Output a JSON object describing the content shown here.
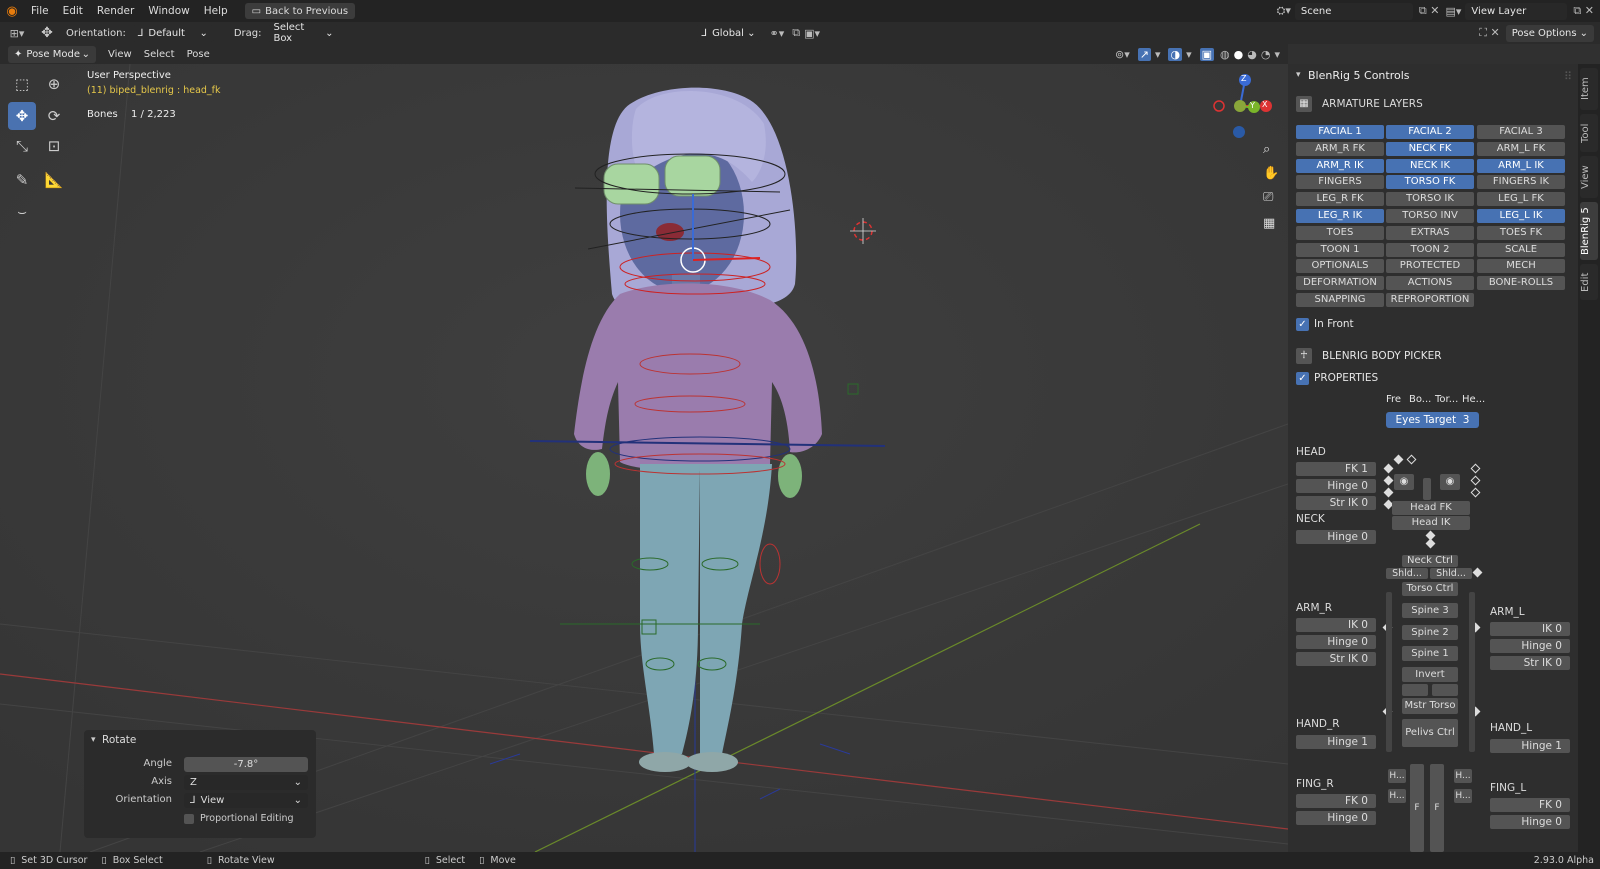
{
  "menu": {
    "logo": "blender-logo",
    "items": [
      "File",
      "Edit",
      "Render",
      "Window",
      "Help"
    ],
    "back_label": "Back to Previous"
  },
  "topright": {
    "scene_label": "Scene",
    "viewlayer_label": "View Layer"
  },
  "header": {
    "orientation_label": "Orientation:",
    "orientation_value": "Default",
    "drag_label": "Drag:",
    "drag_value": "Select Box",
    "transform_orientation": "Global",
    "pose_options": "Pose Options"
  },
  "header3": {
    "mode": "Pose Mode",
    "items": [
      "View",
      "Select",
      "Pose"
    ]
  },
  "viewport": {
    "perspective": "User Perspective",
    "object_info": "(11) biped_blenrig : head_fk",
    "bones_label": "Bones",
    "bones_value": "1 / 2,223"
  },
  "gizmo": {
    "z": "Z",
    "y": "Y",
    "x": "X"
  },
  "rotate": {
    "title": "Rotate",
    "angle_label": "Angle",
    "angle_value": "-7.8°",
    "axis_label": "Axis",
    "axis_value": "Z",
    "orient_label": "Orientation",
    "orient_value": "View",
    "proportional_label": "Proportional Editing"
  },
  "panel": {
    "title": "BlenRig 5 Controls",
    "armature_layers_title": "ARMATURE LAYERS",
    "layers": [
      {
        "label": "FACIAL 1",
        "on": true
      },
      {
        "label": "FACIAL 2",
        "on": true
      },
      {
        "label": "FACIAL 3",
        "on": false
      },
      {
        "label": "ARM_R FK",
        "on": false
      },
      {
        "label": "NECK FK",
        "on": true
      },
      {
        "label": "ARM_L FK",
        "on": false
      },
      {
        "label": "ARM_R IK",
        "on": true
      },
      {
        "label": "NECK IK",
        "on": true
      },
      {
        "label": "ARM_L IK",
        "on": true
      },
      {
        "label": "FINGERS",
        "on": false
      },
      {
        "label": "TORSO FK",
        "on": true
      },
      {
        "label": "FINGERS IK",
        "on": false
      },
      {
        "label": "LEG_R FK",
        "on": false
      },
      {
        "label": "TORSO IK",
        "on": false
      },
      {
        "label": "LEG_L FK",
        "on": false
      },
      {
        "label": "LEG_R IK",
        "on": true
      },
      {
        "label": "TORSO INV",
        "on": false
      },
      {
        "label": "LEG_L IK",
        "on": true
      },
      {
        "label": "TOES",
        "on": false
      },
      {
        "label": "EXTRAS",
        "on": false
      },
      {
        "label": "TOES FK",
        "on": false
      },
      {
        "label": "TOON 1",
        "on": false
      },
      {
        "label": "TOON 2",
        "on": false
      },
      {
        "label": "SCALE",
        "on": false
      },
      {
        "label": "OPTIONALS",
        "on": false
      },
      {
        "label": "PROTECTED",
        "on": false
      },
      {
        "label": "MECH",
        "on": false
      },
      {
        "label": "DEFORMATION",
        "on": false
      },
      {
        "label": "ACTIONS",
        "on": false
      },
      {
        "label": "BONE-ROLLS",
        "on": false
      },
      {
        "label": "SNAPPING",
        "on": false
      },
      {
        "label": "REPROPORTION",
        "on": false
      }
    ],
    "in_front": "In Front",
    "body_picker_title": "BLENRIG BODY PICKER",
    "properties": "PROPERTIES",
    "prop_tabs": [
      "Fre",
      "Bo...",
      "Tor...",
      "He..."
    ],
    "eyes_target": "Eyes Target",
    "eyes_target_value": "3",
    "head": {
      "title": "HEAD",
      "fk": "FK 1",
      "hinge": "Hinge 0",
      "str_ik": "Str IK 0"
    },
    "neck": {
      "title": "NECK",
      "hinge": "Hinge 0"
    },
    "arm_r": {
      "title": "ARM_R",
      "ik": "IK 0",
      "hinge": "Hinge 0",
      "str_ik": "Str IK 0"
    },
    "arm_l": {
      "title": "ARM_L",
      "ik": "IK 0",
      "hinge": "Hinge 0",
      "str_ik": "Str IK 0"
    },
    "hand_r": {
      "title": "HAND_R",
      "hinge": "Hinge 1"
    },
    "hand_l": {
      "title": "HAND_L",
      "hinge": "Hinge 1"
    },
    "fing_r": {
      "title": "FING_R",
      "fk": "FK 0",
      "hinge": "Hinge 0"
    },
    "fing_l": {
      "title": "FING_L",
      "fk": "FK 0",
      "hinge": "Hinge 0"
    },
    "center": {
      "head_fk": "Head FK",
      "head_ik": "Head IK",
      "neck_ctrl": "Neck Ctrl",
      "shld_l": "Shld...",
      "shld_r": "Shld...",
      "torso_ctrl": "Torso Ctrl",
      "spine3": "Spine 3",
      "spine2": "Spine 2",
      "spine1": "Spine 1",
      "invert": "Invert",
      "mstr_torso": "Mstr Torso",
      "pelvis_ctrl": "Pelivs Ctrl",
      "h1": "H...",
      "h2": "H...",
      "h3": "H...",
      "h4": "H...",
      "f1": "F",
      "f2": "F"
    }
  },
  "tabs": [
    "Item",
    "Tool",
    "View",
    "BlenRig 5",
    "Edit"
  ],
  "status": {
    "set_cursor": "Set 3D Cursor",
    "box_select": "Box Select",
    "rotate_view": "Rotate View",
    "select": "Select",
    "move": "Move",
    "version": "2.93.0 Alpha"
  }
}
